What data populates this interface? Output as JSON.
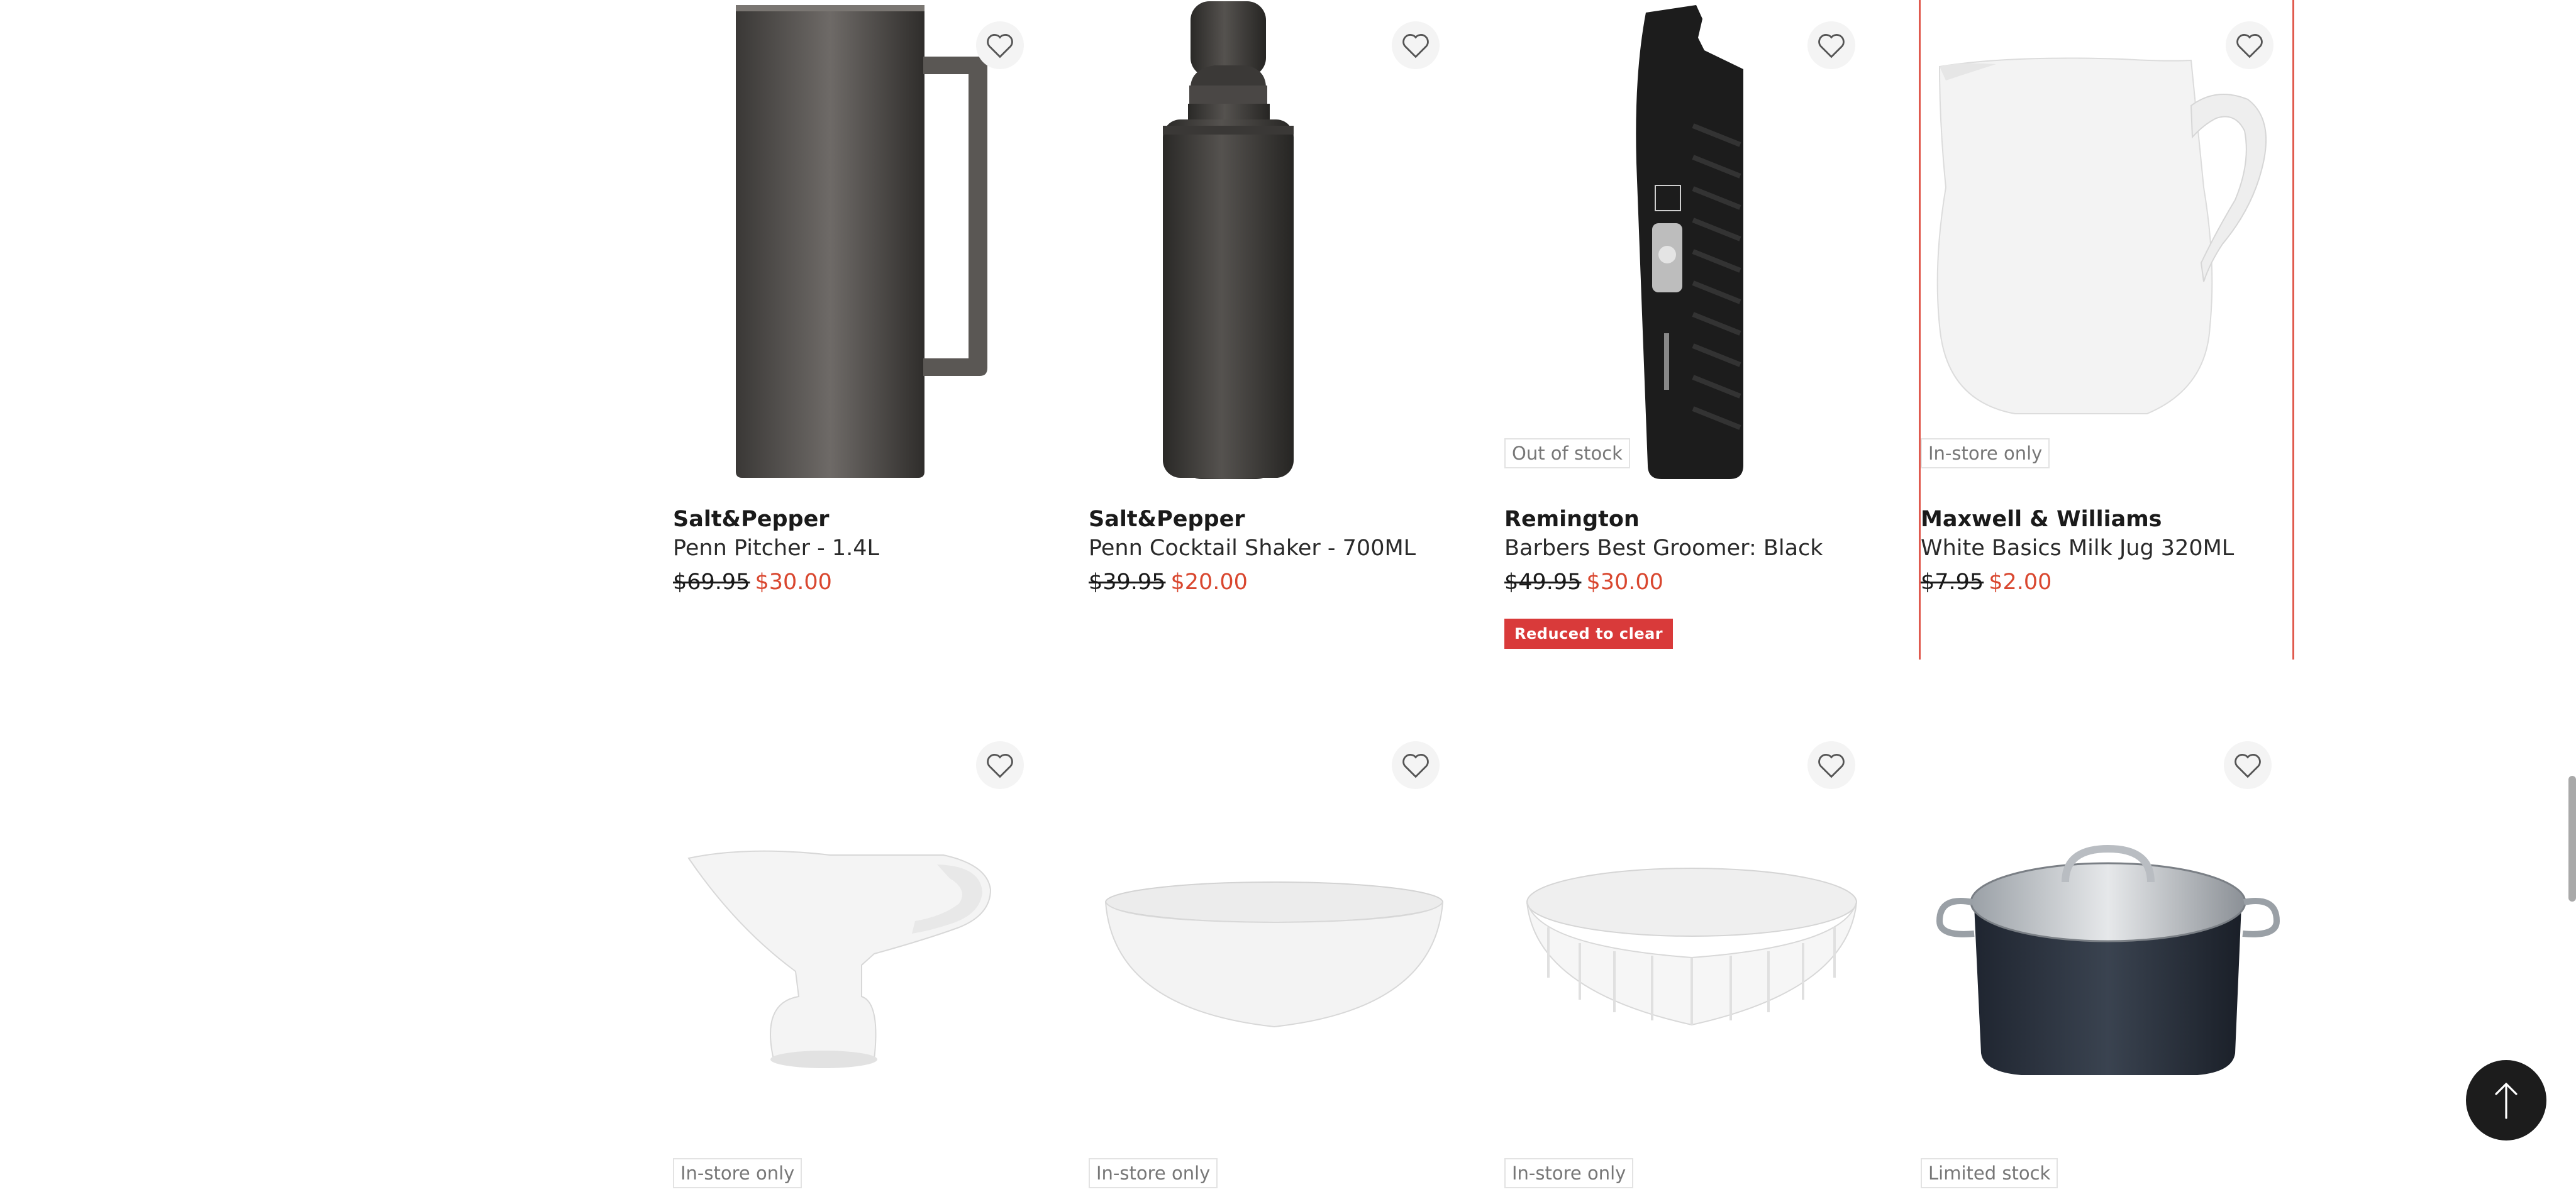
{
  "products": [
    {
      "brand": "Salt&Pepper",
      "name": "Penn Pitcher - 1.4L",
      "was": "$69.95",
      "now": "$30.00",
      "stock": "",
      "badge": ""
    },
    {
      "brand": "Salt&Pepper",
      "name": "Penn Cocktail Shaker - 700ML",
      "was": "$39.95",
      "now": "$20.00",
      "stock": "",
      "badge": ""
    },
    {
      "brand": "Remington",
      "name": "Barbers Best Groomer: Black",
      "was": "$49.95",
      "now": "$30.00",
      "stock": "Out of stock",
      "badge": "Reduced to clear"
    },
    {
      "brand": "Maxwell & Williams",
      "name": "White Basics Milk Jug 320ML",
      "was": "$7.95",
      "now": "$2.00",
      "stock": "In-store only",
      "badge": ""
    }
  ],
  "second_row": [
    {
      "product": "gravy boat",
      "stock": "In-store only"
    },
    {
      "product": "oval baking dish",
      "stock": "In-store only"
    },
    {
      "product": "quiche dish",
      "stock": "In-store only"
    },
    {
      "product": "stockpot with lid",
      "stock": "Limited stock"
    }
  ],
  "icons": {
    "favorite": "heart-outline-icon",
    "back_to_top": "arrow-up-icon"
  },
  "colors": {
    "sale_price": "#d9472f",
    "badge_bg": "#d93a3a",
    "highlight_border": "#e05a4e",
    "back_to_top_bg": "#1c1c1c"
  }
}
